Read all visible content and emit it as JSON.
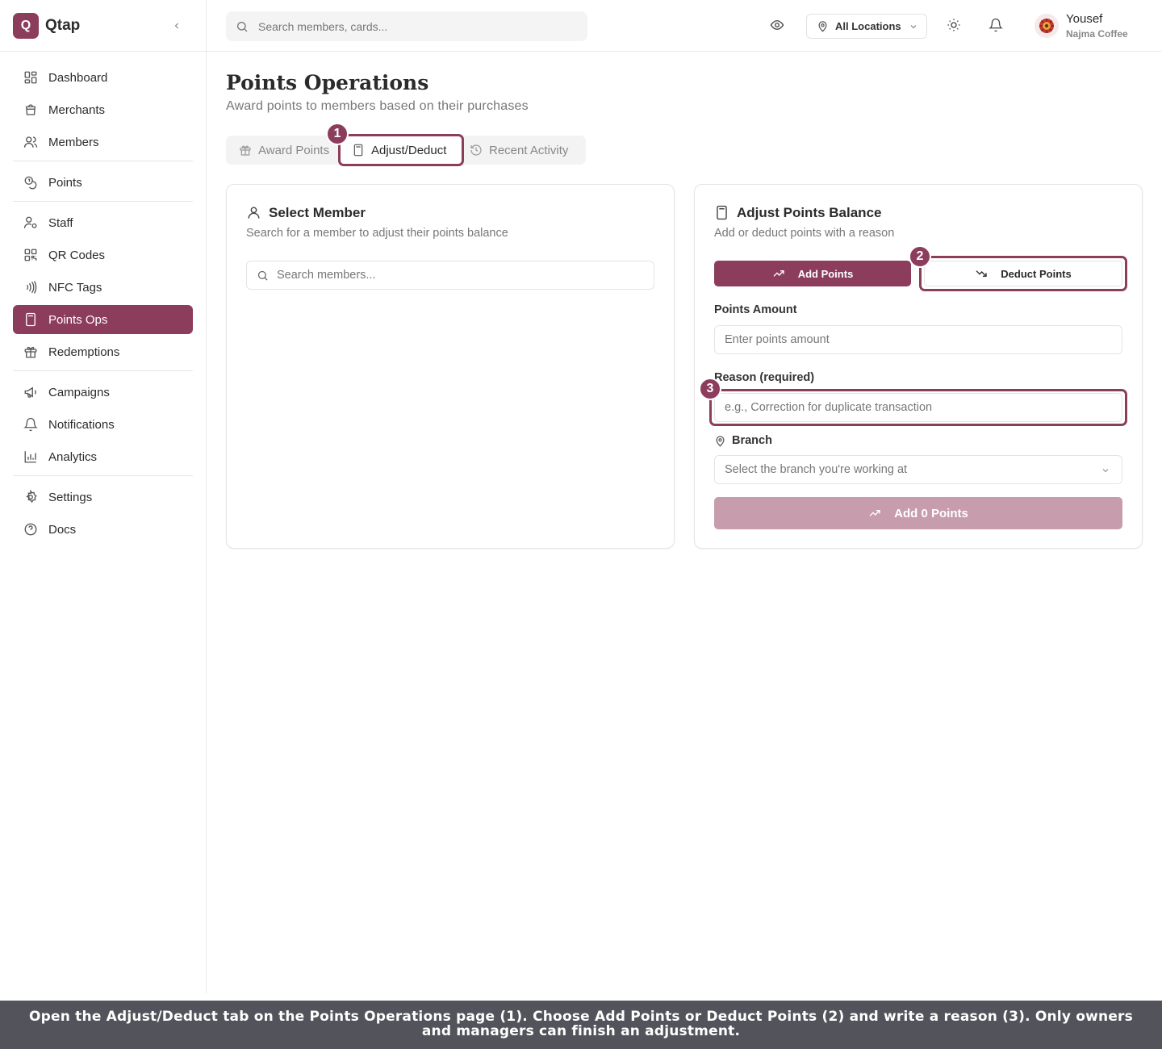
{
  "brand": {
    "logo_letter": "Q",
    "name": "Qtap"
  },
  "sidebar": {
    "items": [
      {
        "label": "Dashboard",
        "icon": "dashboard-icon"
      },
      {
        "label": "Merchants",
        "icon": "shopping-bag-icon"
      },
      {
        "label": "Members",
        "icon": "users-icon"
      },
      {
        "label": "Points",
        "icon": "coins-icon"
      },
      {
        "label": "Staff",
        "icon": "user-cog-icon"
      },
      {
        "label": "QR Codes",
        "icon": "qr-code-icon"
      },
      {
        "label": "NFC Tags",
        "icon": "nfc-icon"
      },
      {
        "label": "Points Ops",
        "icon": "calculator-icon",
        "active": true
      },
      {
        "label": "Redemptions",
        "icon": "gift-icon"
      },
      {
        "label": "Campaigns",
        "icon": "megaphone-icon"
      },
      {
        "label": "Notifications",
        "icon": "bell-icon"
      },
      {
        "label": "Analytics",
        "icon": "bar-chart-icon"
      },
      {
        "label": "Settings",
        "icon": "gear-icon"
      },
      {
        "label": "Docs",
        "icon": "help-circle-icon"
      }
    ]
  },
  "header": {
    "search_placeholder": "Search members, cards...",
    "location": "All Locations",
    "user_name": "Yousef",
    "user_org": "Najma Coffee"
  },
  "page": {
    "title": "Points Operations",
    "subtitle": "Award points to members based on their purchases"
  },
  "tabs": [
    {
      "label": "Award Points",
      "icon": "gift-icon"
    },
    {
      "label": "Adjust/Deduct",
      "icon": "calculator-icon",
      "active": true
    },
    {
      "label": "Recent Activity",
      "icon": "history-icon"
    }
  ],
  "select_member": {
    "title": "Select Member",
    "subtitle": "Search for a member to adjust their points balance",
    "search_placeholder": "Search members..."
  },
  "adjust": {
    "title": "Adjust Points Balance",
    "subtitle": "Add or deduct points with a reason",
    "add_label": "Add Points",
    "deduct_label": "Deduct Points",
    "amount_label": "Points Amount",
    "amount_placeholder": "Enter points amount",
    "reason_label": "Reason (required)",
    "reason_placeholder": "e.g., Correction for duplicate transaction",
    "branch_label": "Branch",
    "branch_placeholder": "Select the branch you're working at",
    "submit_label": "Add 0 Points"
  },
  "annotations": {
    "badge_1": "1",
    "badge_2": "2",
    "badge_3": "3"
  },
  "caption": "Open the Adjust/Deduct tab on the Points Operations page (1). Choose Add Points or Deduct Points (2) and write a reason (3). Only owners and managers can finish an adjustment.",
  "colors": {
    "accent": "#8c3d5c",
    "accent_disabled": "#c79cad",
    "caption_bg": "#53545b"
  }
}
